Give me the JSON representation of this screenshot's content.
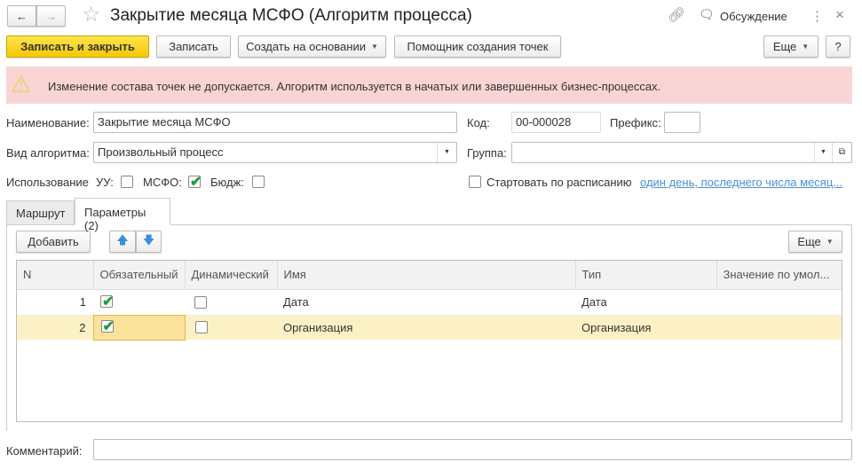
{
  "title": "Закрытие месяца МСФО (Алгоритм процесса)",
  "header": {
    "discuss": "Обсуждение",
    "close": "×"
  },
  "toolbar": {
    "save_close": "Записать и закрыть",
    "save": "Записать",
    "create_based": "Создать на основании",
    "wizard": "Помощник создания точек",
    "more": "Еще",
    "help": "?"
  },
  "warning": "Изменение состава точек не допускается. Алгоритм используется в начатых или завершенных бизнес-процессах.",
  "form": {
    "name_label": "Наименование:",
    "name_value": "Закрытие месяца МСФО",
    "code_label": "Код:",
    "code_value": "00-000028",
    "prefix_label": "Префикс:",
    "prefix_value": "",
    "kind_label": "Вид алгоритма:",
    "kind_value": "Произвольный процесс",
    "group_label": "Группа:",
    "group_value": "",
    "usage_label": "Использование",
    "uu_label": "УУ:",
    "uu_checked": false,
    "ifrs_label": "МСФО:",
    "ifrs_checked": true,
    "budget_label": "Бюдж:",
    "budget_checked": false,
    "schedule_label": "Стартовать по расписанию",
    "schedule_checked": false,
    "schedule_link": "один день, последнего числа месяц..."
  },
  "tabs": [
    {
      "label": "Маршрут",
      "active": false
    },
    {
      "label": "Параметры (2)",
      "active": true
    }
  ],
  "table_toolbar": {
    "add": "Добавить",
    "more": "Еще"
  },
  "table": {
    "columns": [
      "N",
      "Обязательный",
      "Динамический",
      "Имя",
      "Тип",
      "Значение по умол..."
    ],
    "rows": [
      {
        "n": "1",
        "required": true,
        "dynamic": false,
        "name": "Дата",
        "type": "Дата",
        "default": ""
      },
      {
        "n": "2",
        "required": true,
        "dynamic": false,
        "name": "Организация",
        "type": "Организация",
        "default": "",
        "selected": true
      }
    ]
  },
  "comment_label": "Комментарий:",
  "comment_value": ""
}
